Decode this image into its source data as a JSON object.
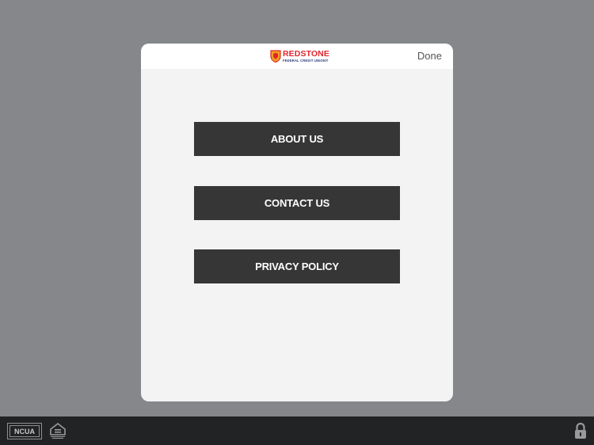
{
  "header": {
    "logo_name": "REDSTONE",
    "logo_subtitle": "FEDERAL CREDIT UNION®",
    "done_label": "Done"
  },
  "menu": {
    "items": [
      {
        "label": "ABOUT US"
      },
      {
        "label": "CONTACT US"
      },
      {
        "label": "PRIVACY POLICY"
      }
    ]
  },
  "footer": {
    "ncua_label": "NCUA",
    "icons": [
      "ncua-badge",
      "equal-housing-lender-icon",
      "lock-icon"
    ]
  },
  "colors": {
    "backdrop": "#85878b",
    "modal_bg": "#f3f3f3",
    "button_bg": "#363636",
    "brand_red": "#e0262f",
    "brand_blue": "#2b3a7c",
    "footer_bg": "#222325"
  }
}
